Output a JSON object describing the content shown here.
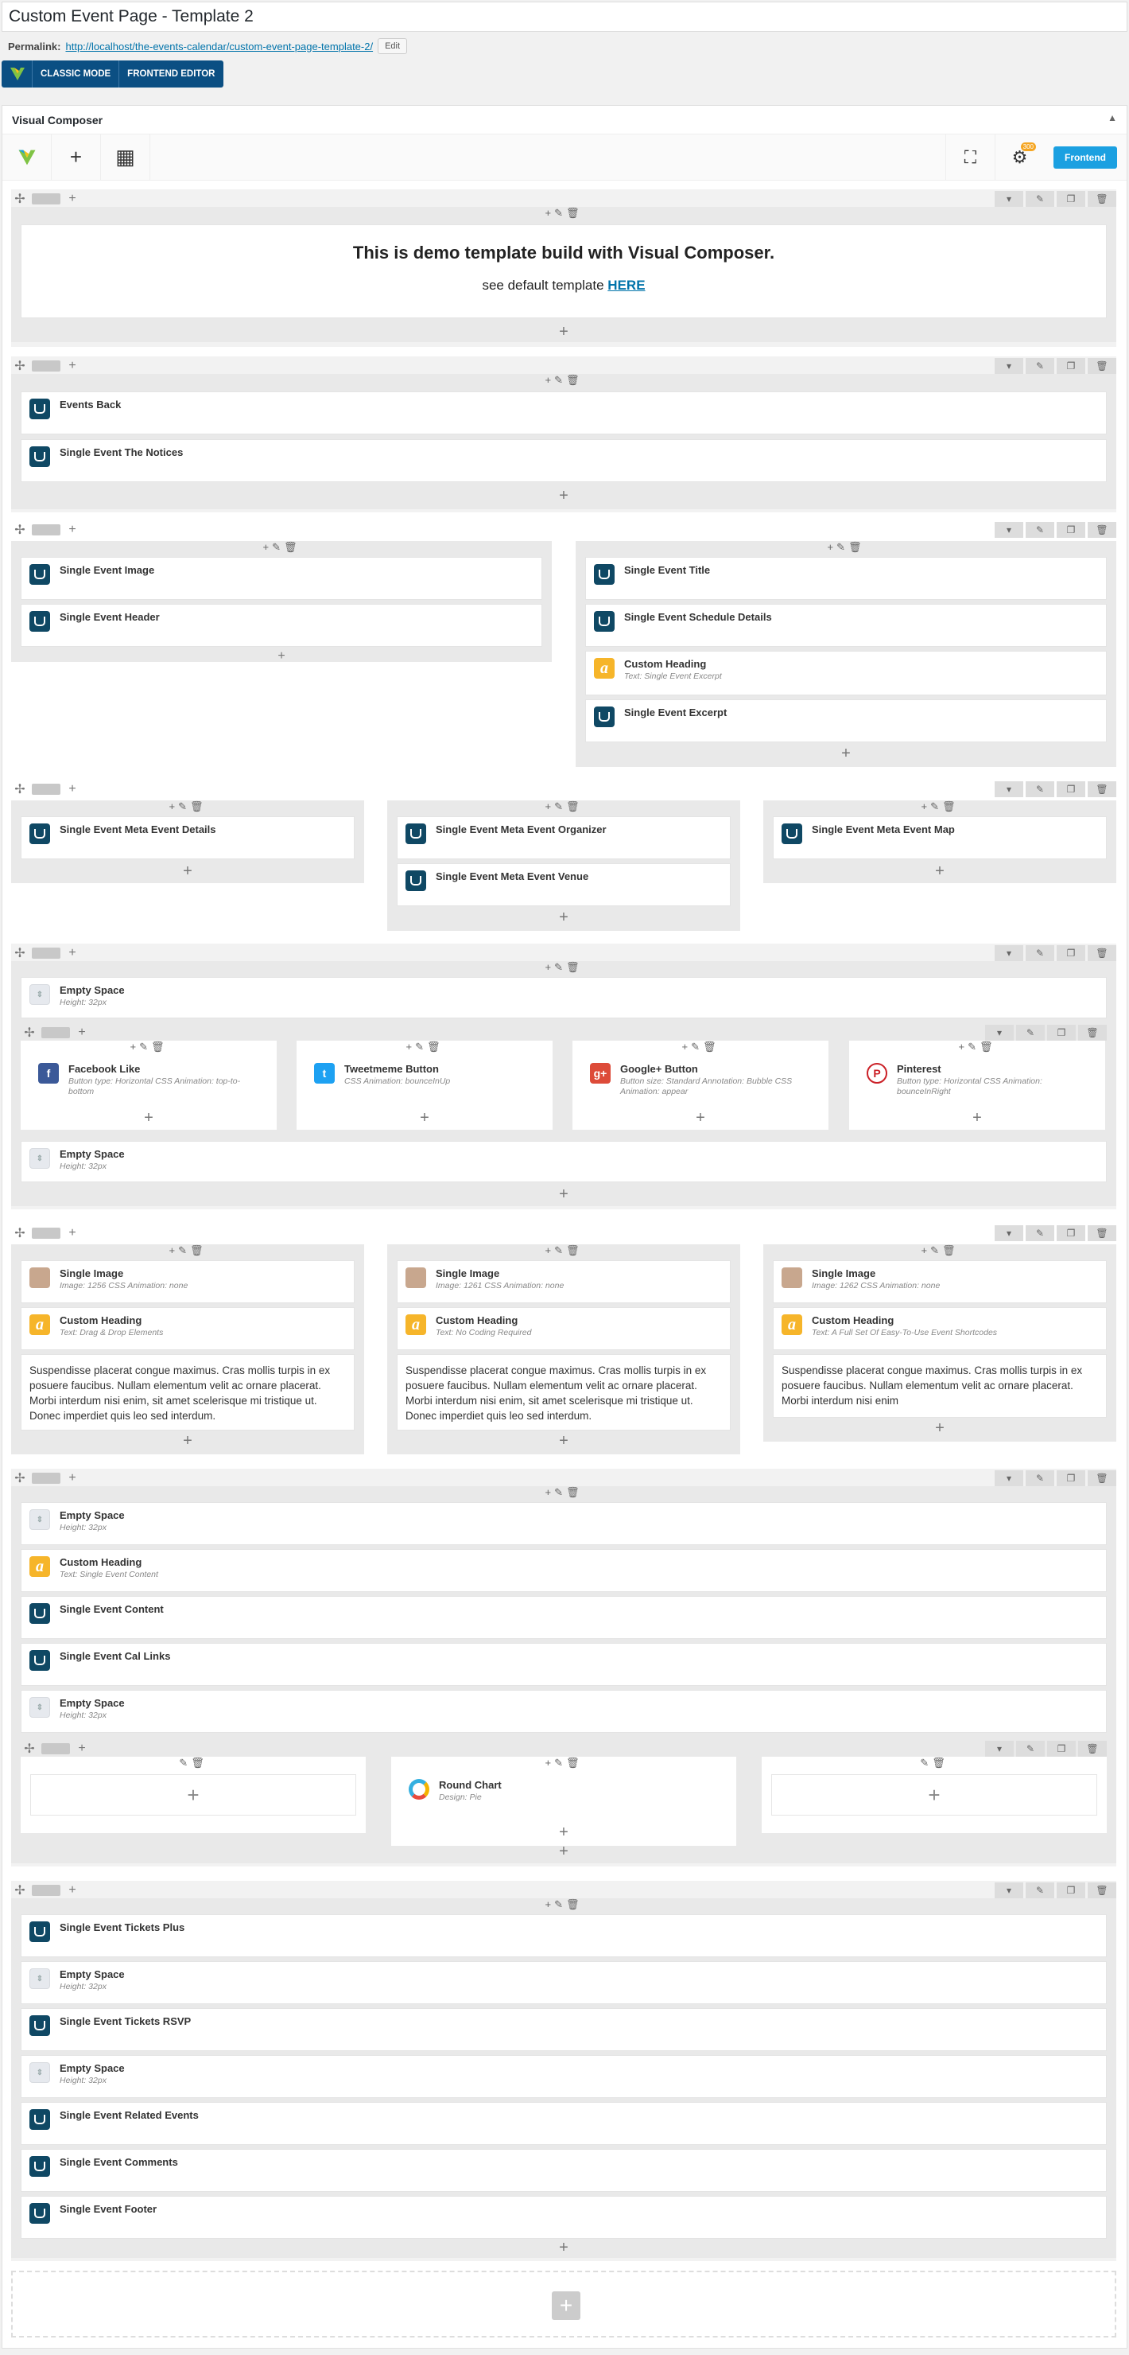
{
  "title": "Custom Event Page - Template 2",
  "permalink": {
    "label": "Permalink:",
    "url": "http://localhost/the-events-calendar/custom-event-page-template-2/",
    "edit": "Edit"
  },
  "modes": {
    "classic": "CLASSIC MODE",
    "frontend": "FRONTEND EDITOR"
  },
  "vc": {
    "title": "Visual Composer",
    "frontend_btn": "Frontend",
    "badge": "300"
  },
  "row1": {
    "heading": "This is demo template build with Visual Composer.",
    "sub": "see default template",
    "link": "HERE"
  },
  "row2": [
    "Events Back",
    "Single Event The Notices"
  ],
  "row3": {
    "left": [
      "Single Event Image",
      "Single Event Header"
    ],
    "right": [
      {
        "t": "Single Event Title"
      },
      {
        "t": "Single Event Schedule Details"
      },
      {
        "t": "Custom Heading",
        "s": "Text: Single Event Excerpt"
      },
      {
        "t": "Single Event Excerpt"
      }
    ]
  },
  "row4": [
    "Single Event Meta Event Details",
    "Single Event Meta Event Organizer",
    "Single Event Meta Event Venue",
    "Single Event Meta Event Map"
  ],
  "row5": {
    "space1": {
      "t": "Empty Space",
      "s": "Height: 32px"
    },
    "social": [
      {
        "t": "Facebook Like",
        "s": "Button type: Horizontal CSS Animation: top-to-bottom"
      },
      {
        "t": "Tweetmeme Button",
        "s": "CSS Animation: bounceInUp"
      },
      {
        "t": "Google+ Button",
        "s": "Button size: Standard Annotation: Bubble CSS Animation: appear"
      },
      {
        "t": "Pinterest",
        "s": "Button type: Horizontal CSS Animation: bounceInRight"
      }
    ],
    "space2": {
      "t": "Empty Space",
      "s": "Height: 32px"
    }
  },
  "row6": [
    {
      "img": "Single Image",
      "imgs": "Image: 1256 CSS Animation: none",
      "h": "Custom Heading",
      "hs": "Text: Drag & Drop Elements",
      "text": "Suspendisse placerat congue maximus. Cras mollis turpis in ex posuere faucibus. Nullam elementum velit ac ornare placerat. Morbi interdum nisi enim, sit amet scelerisque mi tristique ut. Donec imperdiet quis leo sed interdum."
    },
    {
      "img": "Single Image",
      "imgs": "Image: 1261 CSS Animation: none",
      "h": "Custom Heading",
      "hs": "Text: No Coding Required",
      "text": "Suspendisse placerat congue maximus. Cras mollis turpis in ex posuere faucibus. Nullam elementum velit ac ornare placerat. Morbi interdum nisi enim, sit amet scelerisque mi tristique ut. Donec imperdiet quis leo sed interdum."
    },
    {
      "img": "Single Image",
      "imgs": "Image: 1262 CSS Animation: none",
      "h": "Custom Heading",
      "hs": "Text: A Full Set Of Easy-To-Use Event Shortcodes",
      "text": "Suspendisse placerat congue maximus. Cras mollis turpis in ex posuere faucibus. Nullam elementum velit ac ornare placerat. Morbi interdum nisi enim"
    }
  ],
  "row7": {
    "items": [
      {
        "t": "Empty Space",
        "s": "Height: 32px"
      },
      {
        "t": "Custom Heading",
        "s": "Text: Single Event Content"
      },
      {
        "t": "Single Event Content"
      },
      {
        "t": "Single Event Cal Links"
      },
      {
        "t": "Empty Space",
        "s": "Height: 32px"
      }
    ],
    "chart": {
      "t": "Round Chart",
      "s": "Design: Pie"
    }
  },
  "row8": [
    {
      "t": "Single Event Tickets Plus"
    },
    {
      "t": "Empty Space",
      "s": "Height: 32px"
    },
    {
      "t": "Single Event Tickets RSVP"
    },
    {
      "t": "Empty Space",
      "s": "Height: 32px"
    },
    {
      "t": "Single Event Related Events"
    },
    {
      "t": "Single Event Comments"
    },
    {
      "t": "Single Event Footer"
    }
  ]
}
